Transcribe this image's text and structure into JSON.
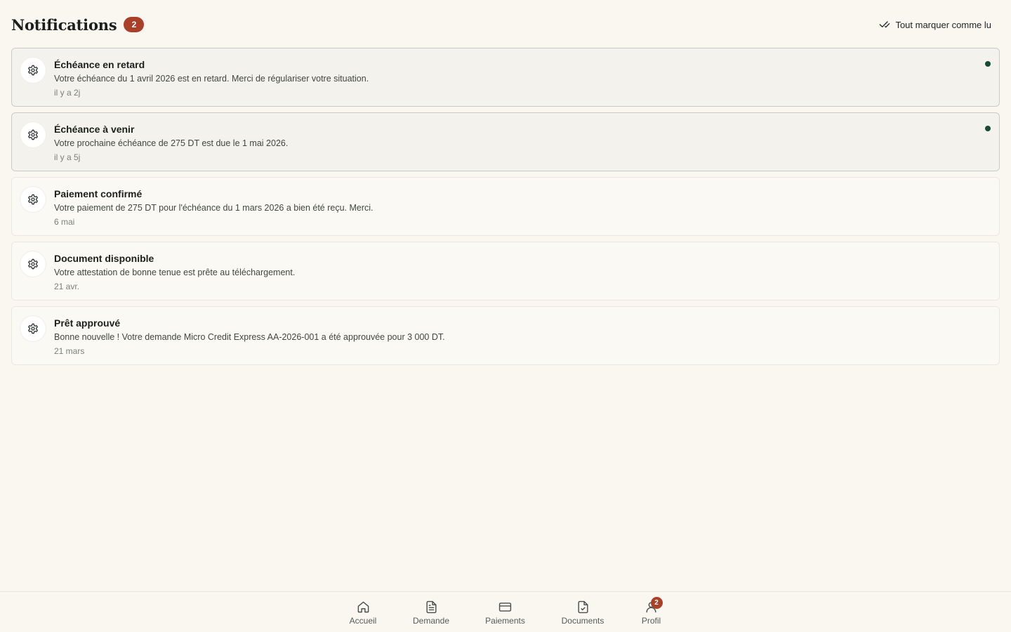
{
  "header": {
    "title": "Notifications",
    "unread_count": "2",
    "mark_all_label": "Tout marquer comme lu",
    "mark_all_icon": "double-check-icon"
  },
  "notifications": [
    {
      "title": "Échéance en retard",
      "text": "Votre échéance du 1 avril 2026 est en retard. Merci de régulariser votre situation.",
      "time": "il y a 2j",
      "unread": true,
      "icon": "gear-icon"
    },
    {
      "title": "Échéance à venir",
      "text": "Votre prochaine échéance de 275 DT est due le 1 mai 2026.",
      "time": "il y a 5j",
      "unread": true,
      "icon": "gear-icon"
    },
    {
      "title": "Paiement confirmé",
      "text": "Votre paiement de 275 DT pour l'échéance du 1 mars 2026 a bien été reçu. Merci.",
      "time": "6 mai",
      "unread": false,
      "icon": "gear-icon"
    },
    {
      "title": "Document disponible",
      "text": "Votre attestation de bonne tenue est prête au téléchargement.",
      "time": "21 avr.",
      "unread": false,
      "icon": "gear-icon"
    },
    {
      "title": "Prêt approuvé",
      "text": "Bonne nouvelle ! Votre demande Micro Credit Express AA-2026-001 a été approuvée pour 3 000 DT.",
      "time": "21 mars",
      "unread": false,
      "icon": "gear-icon"
    }
  ],
  "bottom_nav": {
    "items": [
      {
        "label": "Accueil",
        "icon": "home-icon"
      },
      {
        "label": "Demande",
        "icon": "file-text-icon"
      },
      {
        "label": "Paiements",
        "icon": "credit-card-icon"
      },
      {
        "label": "Documents",
        "icon": "file-check-icon"
      },
      {
        "label": "Profil",
        "icon": "user-icon",
        "badge": "2"
      }
    ]
  },
  "colors": {
    "background": "#faf7f1",
    "badge": "#a8402a",
    "unread_dot": "#1a4a31"
  }
}
